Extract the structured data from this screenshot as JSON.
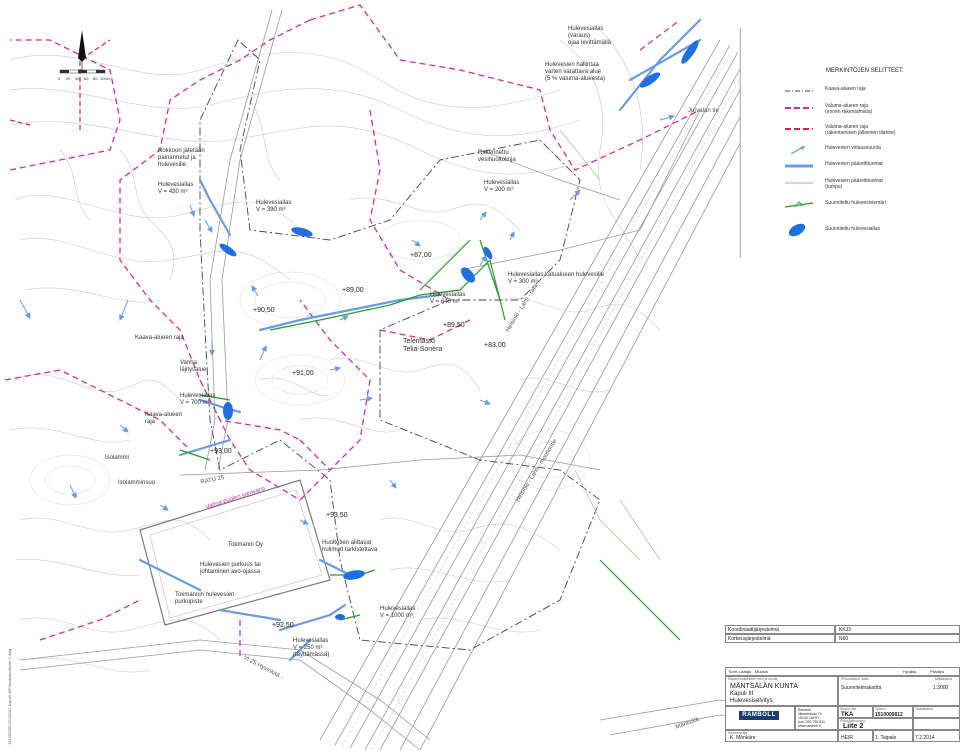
{
  "scale_bar": {
    "ticks": [
      "0",
      "20",
      "40",
      "60",
      "80",
      "100m"
    ]
  },
  "streets": {
    "jarvala": "Jurvalan tie",
    "railway_1": "Helsinki - Lahti - rata",
    "railway_2": "Helsinki - Lahti - moottoritie",
    "vt25": "Vt 25 Hyvinkää - ",
    "ratu": "RATU 25",
    "valma": "Valma-puolen joenvarsi",
    "mantsala": "Mäntsälä"
  },
  "map_labels": {
    "l1": "Hulevesiallas\n(varaus)\nojaa levittämällä",
    "l2": "Hulevesien hallintaa\nvarten varattava alue\n(5 % valuma-alueesta)",
    "l3": "Nokkoon jätetään\npainannetut ja\nhulevesille",
    "l4": "Hulevesiallas\nV = 430 m³",
    "l5": "Hulevesiallas\nV = 390 m³",
    "l6": "Rakennettu\nvesihuoltolinja",
    "l7": "Hulevesiallas\nV = 200 m³",
    "l8": "Hulevesiallas katualueen hulevesille\nV = 300 m³",
    "l9": "Hulevesiallas\nV = 640 m³",
    "l10": "Telemasto\nTelia-Sonera",
    "l11": "Kaava-alueen raja",
    "l12": "Vanha\nläjitysalue",
    "l13": "Hulevesiallas\nV = 700 m³",
    "l14": "Kaava-alueen\nraja",
    "l15": "Isolammi",
    "l16": "Isolamminsuo",
    "l17": "Tokmanni Oy",
    "l18": "Huoltotien alittavat\nhulimurt tarkistettava",
    "l19": "Hulevesien purkuus tai\njohtaminen avo-ojassa",
    "l20": "Tokmannin hulevesien\npurkupiste",
    "l21": "Hulevesiallas\nV = 1000 m³",
    "l22": "Hulevesiallas\nV = 250 m³\n(täyttämässä)"
  },
  "elevations": [
    "+87,00",
    "+89,00",
    "+90,50",
    "+89,50",
    "+83,00",
    "+91,00",
    "+93,00",
    "+93,50",
    "+92,50"
  ],
  "legend": {
    "title": "MERKINTÖJEN SELITTEET:",
    "items": [
      {
        "text": "Kaava-alueen raja",
        "color": "#444444",
        "style": "dashdot"
      },
      {
        "text": "Valuma-alueen raja\n(ennen rakentamista)",
        "color": "#cc2fa8",
        "style": "dash"
      },
      {
        "text": "Valuma-alueen raja\n(rakentamisen jälkeinen tilanne)",
        "color": "#e0203a",
        "style": "dash"
      },
      {
        "text": "Hulevesien virtaussuunta",
        "color": "#6a9be0",
        "style": "arrow"
      },
      {
        "text": "Hulevesien pääreittiuomat",
        "color": "#6a9be0",
        "style": "thick"
      },
      {
        "text": "Hulevesien pääreittiuomat\n(tumpu)",
        "color": "#7ecf7e",
        "style": "thin"
      },
      {
        "text": "Suunniteltu hulevesiviemäri",
        "color": "#2a9a2a",
        "style": "sewer"
      },
      {
        "text": "Suunniteltu hulevesiallas",
        "color": "#1f6fe0",
        "style": "pond"
      }
    ]
  },
  "title_block": {
    "coord_label": "Koordinaattijärjestelmä",
    "coord_value": "KKJ3",
    "height_label": "Korkeusjärjestelmä",
    "height_value": "N60",
    "rev_headers": [
      "Tunn.",
      "Laatija",
      "Muutos",
      "Hyväks.",
      "Päiväys"
    ],
    "client_label": "Rakennuskohteen nimi ja osoite",
    "client": "MÄNTSÄLÄN KUNTA",
    "project": "Kapuli III",
    "subject": "Hulevesiselvitys",
    "plan_type_label": "Piirustuksen laatu",
    "plan_type": "Suunnitelmakartta",
    "scale_label": "Mittakaava",
    "scale": "1:3000",
    "company": "RAMBOLL",
    "company_addr": "Ramboll\nNiemenkatu 73\n15140 LAHTI\npuh. 020 755 611\nwww.ramboll.fi",
    "designer_label": "Suunnittelija",
    "designer": "K. Mönkäre",
    "drawn_label": "Suunn.ala",
    "drawn": "TKA",
    "job_label": "Työnro",
    "job": "1510009812",
    "drawing_no_label": "Piirustusnumero",
    "drawing_no": "Liite 2",
    "checker_label": "Tarkastanut",
    "checker": "HEIR",
    "phase": "1. Taipale",
    "date": "7.2.2014"
  },
  "side_path": "1510009812/CAD/02 Kapuli III/Piirustukset/Liite 2.dwg"
}
